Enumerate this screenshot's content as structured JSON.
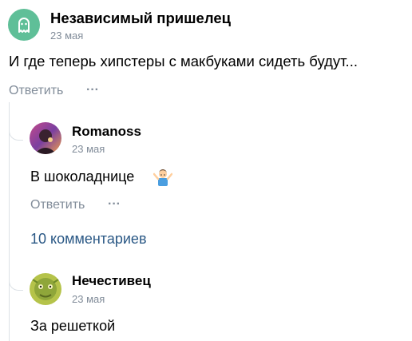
{
  "comments": [
    {
      "author": "Независимый пришелец",
      "date": "23 мая",
      "text": "И где теперь хипстеры с макбуками сидеть будут...",
      "reply_label": "Ответить",
      "more_label": "···",
      "avatar_icon": "ghost-icon",
      "avatar_color": "#5fbf98"
    },
    {
      "author": "Romanoss",
      "date": "23 мая",
      "text": "В шоколаднице",
      "emoji_icon": "person-shrugging-icon",
      "reply_label": "Ответить",
      "more_label": "···",
      "avatar_icon": "user-photo"
    },
    {
      "author": "Нечестивец",
      "date": "23 мая",
      "text": "За решеткой",
      "avatar_icon": "user-photo"
    }
  ],
  "more_comments_label": "10 комментариев",
  "colors": {
    "meta": "#818c99",
    "link": "#2a5885",
    "thread": "#dce1e6"
  }
}
